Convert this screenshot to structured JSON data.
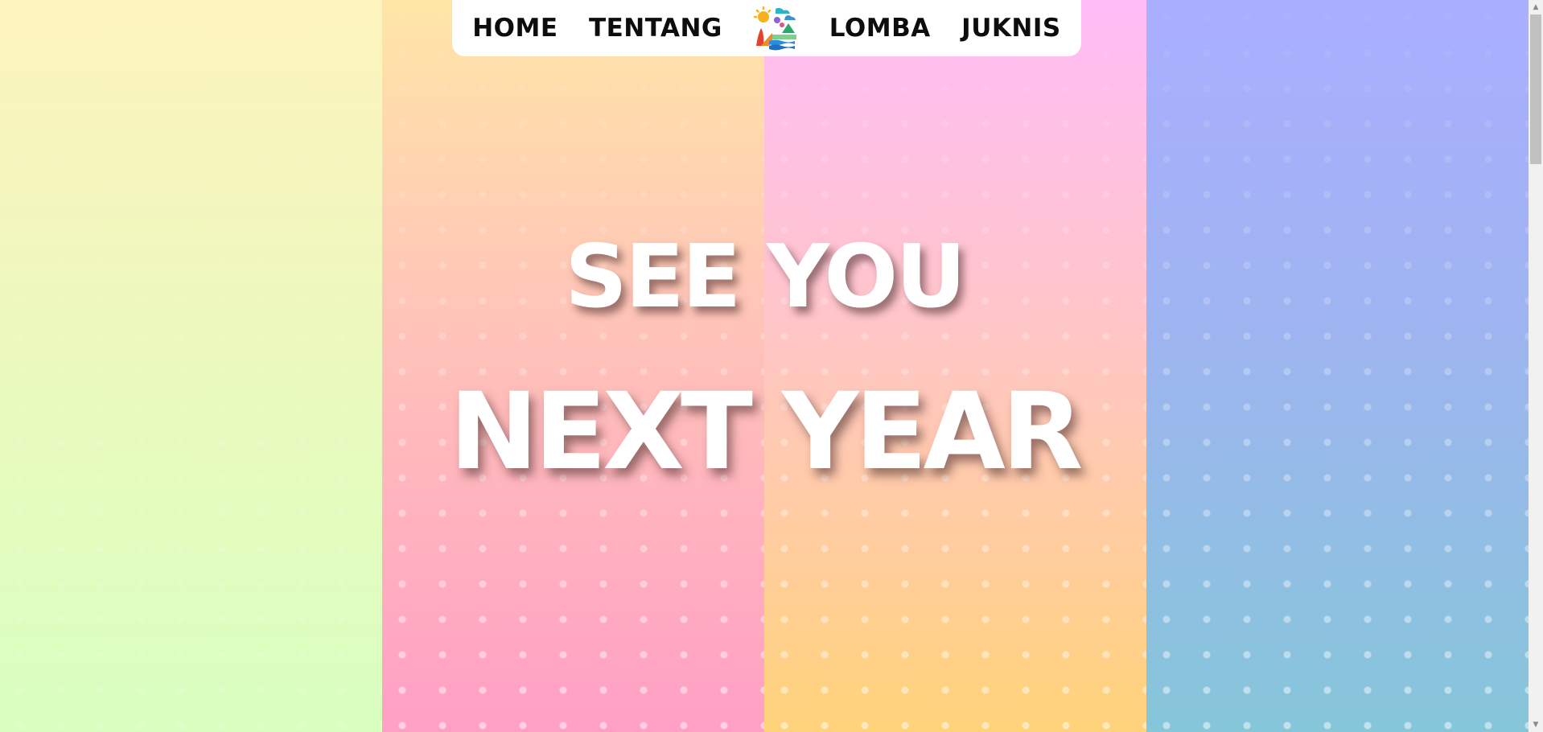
{
  "nav": {
    "items": [
      {
        "label": "HOME"
      },
      {
        "label": "TENTANG"
      },
      {
        "label": "LOMBA"
      },
      {
        "label": "JUKNIS"
      }
    ],
    "logo_icon": "festival-logo-icon"
  },
  "hero": {
    "line1": "SEE YOU",
    "line2": "NEXT YEAR"
  },
  "colors": {
    "panel_1": [
      "#fdf3bd",
      "#d8ffbf"
    ],
    "panel_2": [
      "#ffe6a6",
      "#ffc6b7",
      "#ff9fc5"
    ],
    "panel_3": [
      "#ffbcf7",
      "#ffc6c7",
      "#ffd37a"
    ],
    "panel_4": [
      "#aaaeff",
      "#9eb4f0",
      "#86c6d9"
    ],
    "headline_text": "#ffffff",
    "nav_text": "#0d0d0d"
  },
  "scrollbar": {
    "up_icon": "scroll-up-arrow-icon",
    "down_icon": "scroll-down-arrow-icon"
  }
}
